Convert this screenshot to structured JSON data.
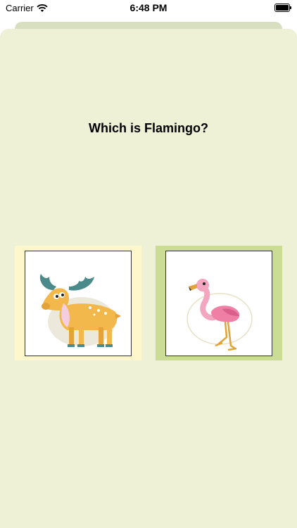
{
  "status_bar": {
    "carrier": "Carrier",
    "time": "6:48 PM"
  },
  "question": "Which is Flamingo?",
  "options": [
    {
      "animal": "moose",
      "card_color": "#fff7cc"
    },
    {
      "animal": "flamingo",
      "card_color": "#cbdc94"
    }
  ]
}
